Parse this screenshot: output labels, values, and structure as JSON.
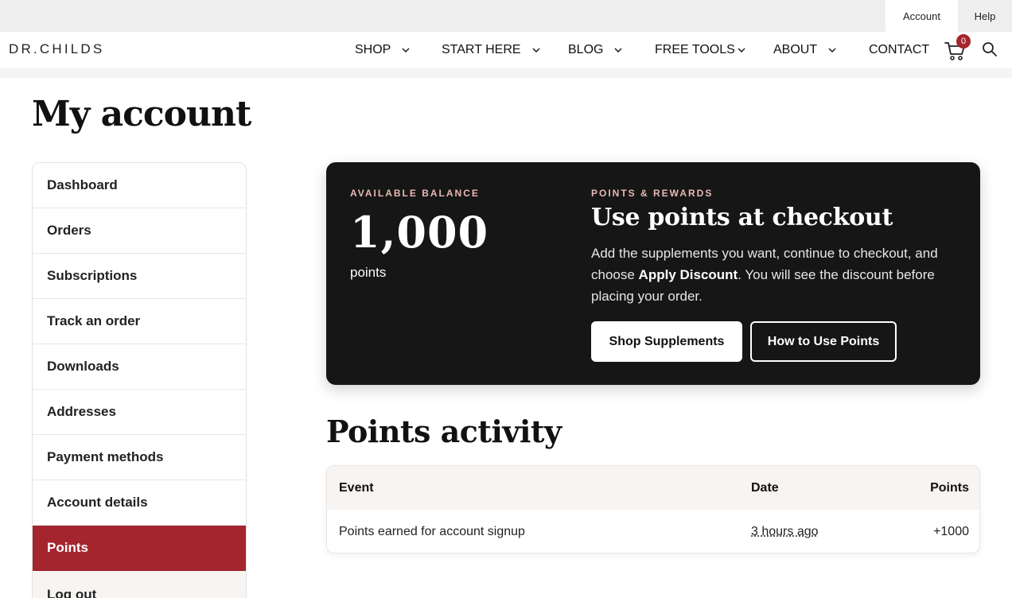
{
  "utility": {
    "account_label": "Account",
    "help_label": "Help"
  },
  "header": {
    "logo": "DR.CHILDS",
    "nav": [
      {
        "label": "SHOP",
        "has_dropdown": true
      },
      {
        "label": "START HERE",
        "has_dropdown": true
      },
      {
        "label": "BLOG",
        "has_dropdown": true
      },
      {
        "label": "FREE TOOLS",
        "has_dropdown": true
      },
      {
        "label": "ABOUT",
        "has_dropdown": true
      },
      {
        "label": "CONTACT",
        "has_dropdown": false
      }
    ],
    "cart_count": "0",
    "icons": {
      "cart": "cart-icon",
      "search": "search-icon"
    }
  },
  "page": {
    "title": "My account"
  },
  "sidebar": {
    "items": [
      {
        "label": "Dashboard"
      },
      {
        "label": "Orders"
      },
      {
        "label": "Subscriptions"
      },
      {
        "label": "Track an order"
      },
      {
        "label": "Downloads"
      },
      {
        "label": "Addresses"
      },
      {
        "label": "Payment methods"
      },
      {
        "label": "Account details"
      },
      {
        "label": "Points",
        "active": true
      },
      {
        "label": "Log out"
      }
    ]
  },
  "balance_card": {
    "balance_label": "AVAILABLE BALANCE",
    "balance_value": "1,000",
    "balance_unit": "points",
    "rewards_label": "POINTS & REWARDS",
    "headline": "Use points at checkout",
    "body_before": "Add the supplements you want, continue to checkout, and choose ",
    "body_bold": "Apply Discount",
    "body_after": ". You will see the discount before placing your order.",
    "shop_button": "Shop Supplements",
    "how_button": "How to Use Points"
  },
  "activity": {
    "title": "Points activity",
    "columns": {
      "event": "Event",
      "date": "Date",
      "points": "Points"
    },
    "rows": [
      {
        "event": "Points earned for account signup",
        "date": "3 hours ago",
        "points": "+1000"
      }
    ]
  },
  "colors": {
    "accent": "#a5252e",
    "card_bg": "#161616",
    "eyebrow": "#e8b9b2",
    "table_header_bg": "#f7f4f1"
  }
}
